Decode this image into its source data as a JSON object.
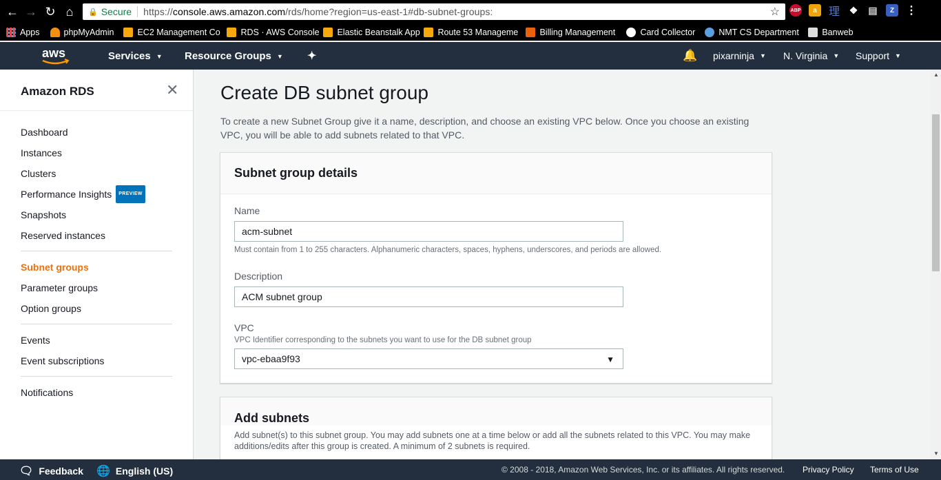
{
  "browser": {
    "secure_label": "Secure",
    "url_scheme": "https://",
    "url_host": "console.aws.amazon.com",
    "url_path": "/rds/home?region=us-east-1#db-subnet-groups:",
    "extensions": [
      "ABP",
      "a",
      "理",
      "dropbox",
      "cast",
      "Z"
    ]
  },
  "bookmarks": [
    "Apps",
    "phpMyAdmin",
    "EC2 Management Co",
    "RDS · AWS Console",
    "Elastic Beanstalk App",
    "Route 53 Manageme",
    "Billing Management",
    "Card Collector",
    "NMT CS Department",
    "Banweb"
  ],
  "aws_header": {
    "logo": "aws",
    "services": "Services",
    "resource_groups": "Resource Groups",
    "user": "pixarninja",
    "region": "N. Virginia",
    "support": "Support"
  },
  "sidebar": {
    "title": "Amazon RDS",
    "groups": [
      [
        {
          "label": "Dashboard"
        },
        {
          "label": "Instances"
        },
        {
          "label": "Clusters"
        },
        {
          "label": "Performance Insights",
          "badge": "PREVIEW"
        },
        {
          "label": "Snapshots"
        },
        {
          "label": "Reserved instances"
        }
      ],
      [
        {
          "label": "Subnet groups",
          "active": true
        },
        {
          "label": "Parameter groups"
        },
        {
          "label": "Option groups"
        }
      ],
      [
        {
          "label": "Events"
        },
        {
          "label": "Event subscriptions"
        }
      ],
      [
        {
          "label": "Notifications"
        }
      ]
    ]
  },
  "main": {
    "title": "Create DB subnet group",
    "intro": "To create a new Subnet Group give it a name, description, and choose an existing VPC below. Once you choose an existing VPC, you will be able to add subnets related to that VPC.",
    "details_panel": {
      "heading": "Subnet group details",
      "name_label": "Name",
      "name_value": "acm-subnet",
      "name_hint": "Must contain from 1 to 255 characters. Alphanumeric characters, spaces, hyphens, underscores, and periods are allowed.",
      "description_label": "Description",
      "description_value": "ACM subnet group",
      "vpc_label": "VPC",
      "vpc_hint": "VPC Identifier corresponding to the subnets you want to use for the DB subnet group",
      "vpc_value": "vpc-ebaa9f93"
    },
    "subnets_panel": {
      "heading": "Add subnets",
      "description": "Add subnet(s) to this subnet group. You may add subnets one at a time below or add all the subnets related to this VPC. You may make additions/edits after this group is created. A minimum of 2 subnets is required."
    }
  },
  "footer": {
    "feedback": "Feedback",
    "language": "English (US)",
    "copyright": "© 2008 - 2018, Amazon Web Services, Inc. or its affiliates. All rights reserved.",
    "privacy": "Privacy Policy",
    "terms": "Terms of Use"
  }
}
